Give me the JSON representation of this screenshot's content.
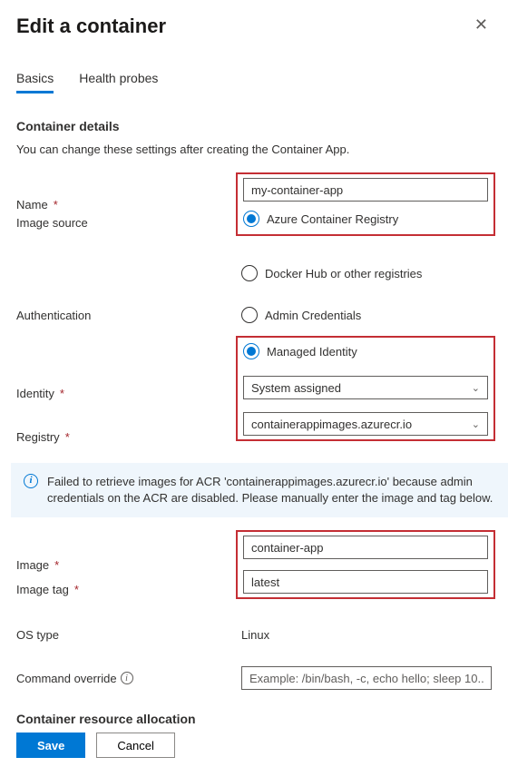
{
  "header": {
    "title": "Edit a container"
  },
  "tabs": {
    "basics": "Basics",
    "health_probes": "Health probes"
  },
  "section1": {
    "title": "Container details",
    "desc": "You can change these settings after creating the Container App."
  },
  "fields": {
    "name_label": "Name",
    "name_value": "my-container-app",
    "image_source_label": "Image source",
    "image_source_acr": "Azure Container Registry",
    "image_source_docker": "Docker Hub or other registries",
    "auth_label": "Authentication",
    "auth_admin": "Admin Credentials",
    "auth_mi": "Managed Identity",
    "identity_label": "Identity",
    "identity_value": "System assigned",
    "registry_label": "Registry",
    "registry_value": "containerappimages.azurecr.io",
    "image_label": "Image",
    "image_value": "container-app",
    "image_tag_label": "Image tag",
    "image_tag_value": "latest",
    "os_type_label": "OS type",
    "os_type_value": "Linux",
    "cmd_override_label": "Command override",
    "cmd_override_placeholder": "Example: /bin/bash, -c, echo hello; sleep 10..."
  },
  "info": {
    "text": "Failed to retrieve images for ACR 'containerappimages.azurecr.io' because admin credentials on the ACR are disabled. Please manually enter the image and tag below."
  },
  "section2": {
    "title": "Container resource allocation"
  },
  "footer": {
    "save": "Save",
    "cancel": "Cancel"
  }
}
